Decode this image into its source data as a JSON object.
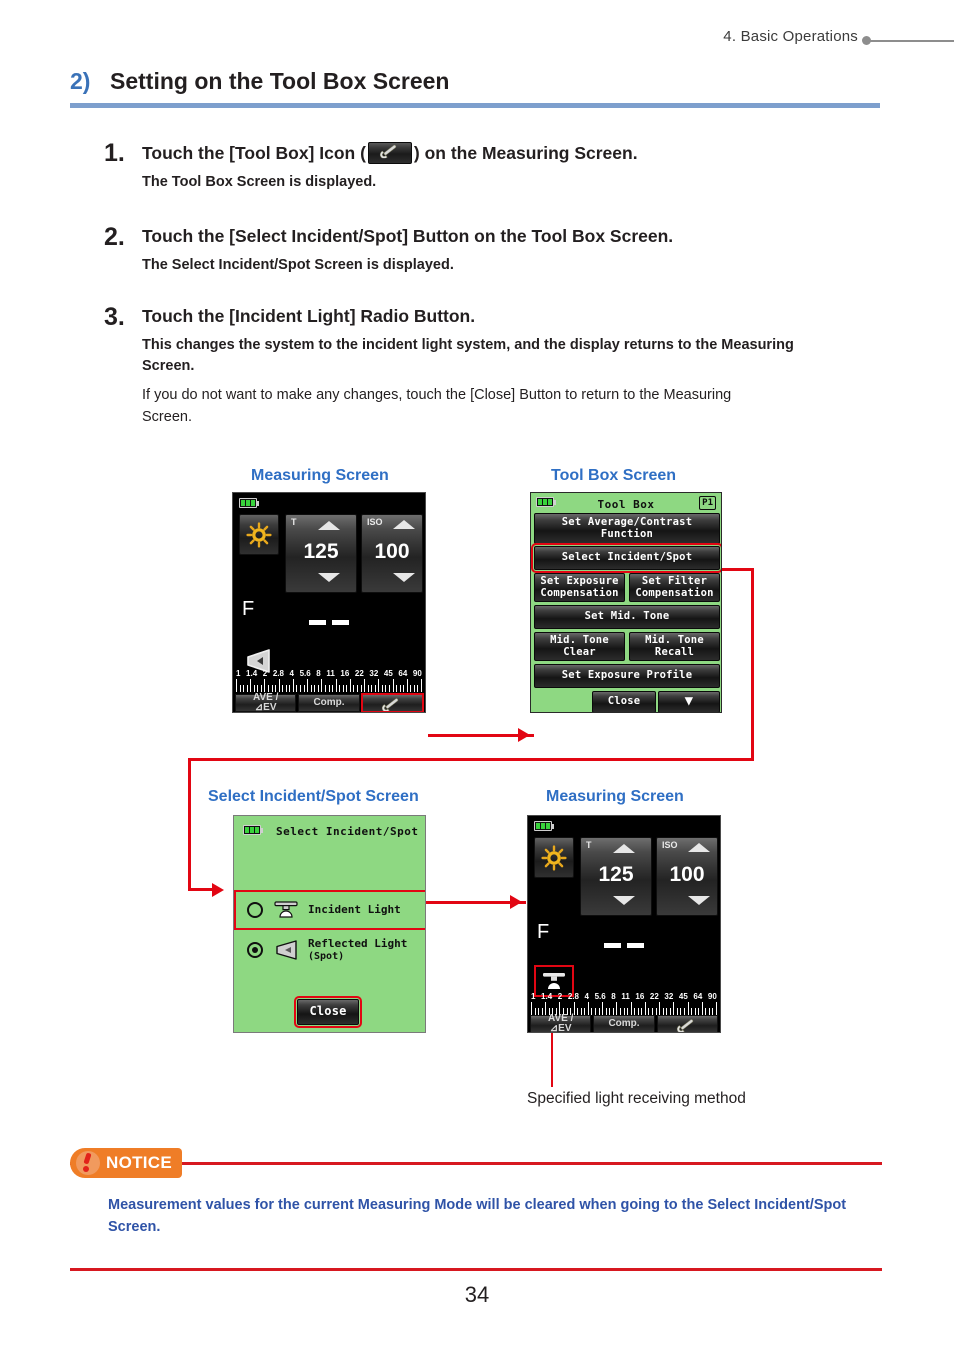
{
  "header": {
    "chapter": "4.  Basic Operations"
  },
  "section": {
    "number": "2)",
    "title": "Setting on the Tool Box Screen"
  },
  "steps": [
    {
      "number": "1.",
      "head_before": "Touch the [Tool Box] Icon (",
      "head_after": ") on the Measuring Screen.",
      "icon": "wrench-icon",
      "sub": "The Tool Box Screen is displayed."
    },
    {
      "number": "2.",
      "head": "Touch the [Select Incident/Spot] Button on the Tool Box Screen.",
      "sub": "The Select Incident/Spot Screen is displayed."
    },
    {
      "number": "3.",
      "head": "Touch the [Incident Light] Radio Button.",
      "sub": "This changes the system to the incident light system, and the display returns to the Measuring Screen.",
      "note": "If you do not want to make any changes, touch the [Close] Button to return to the Measuring Screen."
    }
  ],
  "figures": {
    "labels": {
      "measuring_top": "Measuring Screen",
      "toolbox": "Tool Box Screen",
      "select_incident": "Select Incident/Spot Screen",
      "measuring_bottom": "Measuring Screen"
    },
    "caption": "Specified light receiving method",
    "measuring_screen": {
      "battery": "battery-icon",
      "mode_icon": "sun-icon",
      "shutter": {
        "label": "T",
        "value": "125"
      },
      "iso": {
        "label": "ISO",
        "value": "100"
      },
      "aperture_label": "F",
      "aperture_value": "– –",
      "light_icon_top": "reflected-light-spot-icon",
      "light_icon_bottom": "incident-light-dome-icon",
      "scale": [
        "1",
        "1.4",
        "2",
        "2.8",
        "4",
        "5.6",
        "8",
        "11",
        "16",
        "22",
        "32",
        "45",
        "64",
        "90"
      ],
      "buttons": [
        {
          "name": "ave-ev-button",
          "line1": "AVE /",
          "line2": "⊿EV"
        },
        {
          "name": "comp-button",
          "line1": "Comp.",
          "line2": ""
        },
        {
          "name": "tool-box-button",
          "line1": "",
          "line2": ""
        }
      ]
    },
    "tool_box_screen": {
      "title": "Tool Box",
      "page_badge": "P1",
      "buttons": [
        {
          "name": "set-average-contrast-function-button",
          "line1": "Set Average/Contrast",
          "line2": "Function",
          "highlight": false
        },
        {
          "name": "select-incident-spot-button",
          "line1": "Select Incident/Spot",
          "line2": "",
          "highlight": true
        },
        {
          "name": "set-exposure-compensation-button",
          "line1": "Set Exposure",
          "line2": "Compensation",
          "highlight": false
        },
        {
          "name": "set-filter-compensation-button",
          "line1": "Set Filter",
          "line2": "Compensation",
          "highlight": false
        },
        {
          "name": "set-mid-tone-button",
          "line1": "Set Mid. Tone",
          "line2": "",
          "highlight": false
        },
        {
          "name": "mid-tone-clear-button",
          "line1": "Mid. Tone",
          "line2": "Clear",
          "highlight": false
        },
        {
          "name": "mid-tone-recall-button",
          "line1": "Mid. Tone",
          "line2": "Recall",
          "highlight": false
        },
        {
          "name": "set-exposure-profile-button",
          "line1": "Set Exposure Profile",
          "line2": "",
          "highlight": false
        },
        {
          "name": "close-button",
          "line1": "Close",
          "line2": "",
          "highlight": false
        },
        {
          "name": "next-page-button",
          "line1": "▼",
          "line2": "",
          "highlight": false
        }
      ]
    },
    "select_incident_spot_screen": {
      "title": "Select Incident/Spot",
      "options": [
        {
          "name": "incident-light-radio",
          "label": "Incident Light",
          "sub": "",
          "selected": false,
          "highlight": true,
          "icon": "incident-light-dome-icon"
        },
        {
          "name": "reflected-light-spot-radio",
          "label": "Reflected Light",
          "sub": "(Spot)",
          "selected": true,
          "highlight": false,
          "icon": "reflected-light-spot-icon"
        }
      ],
      "close_label": "Close"
    }
  },
  "notice": {
    "badge": "NOTICE",
    "text": "Measurement values for the current Measuring Mode will be cleared when going to the Select Incident/Spot Screen."
  },
  "page_number": "34",
  "colors": {
    "accent_blue": "#3a72b8",
    "label_blue": "#2f6fc4",
    "notice_blue": "#2f53a7",
    "notice_orange": "#ef7d27",
    "notice_red": "#d71820",
    "connector_red": "#e20613",
    "screen_green": "#8ed882",
    "battery_green": "#39d33c"
  }
}
